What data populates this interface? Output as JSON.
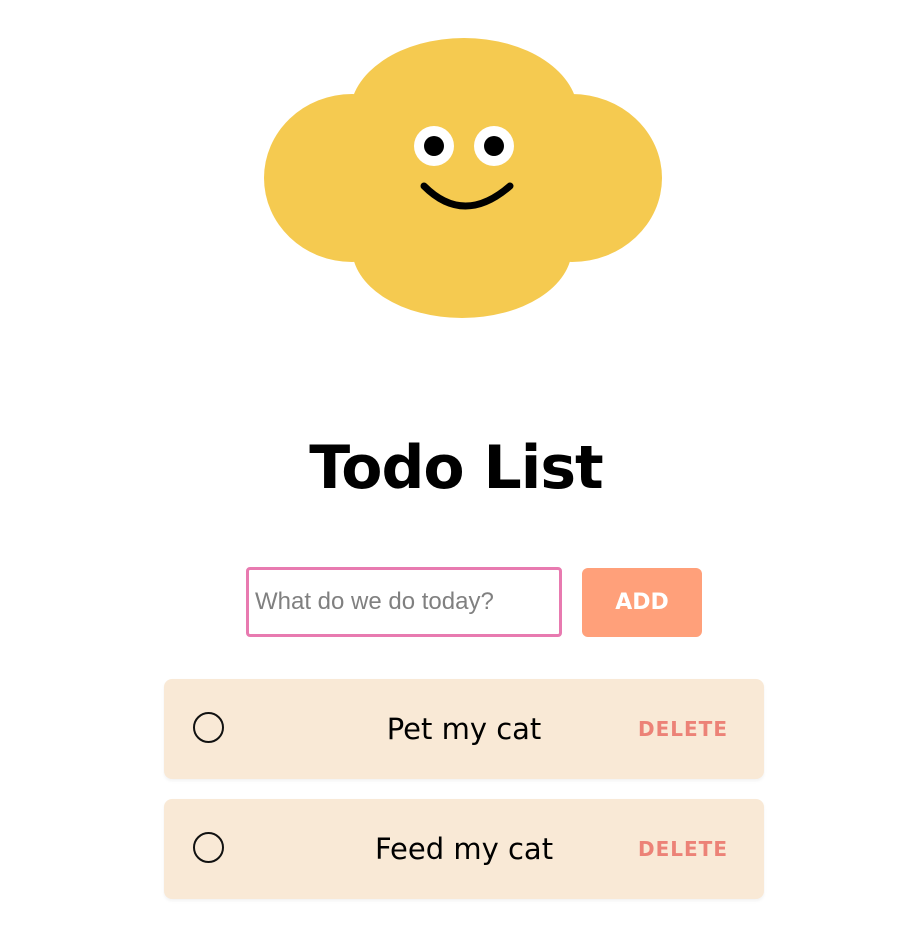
{
  "mascot": {
    "icon": "smiling-cloud-icon",
    "color": "#f5ca50"
  },
  "title": "Todo List",
  "form": {
    "input_value": "",
    "input_placeholder": "What do we do today?",
    "add_label": "ADD"
  },
  "todos": [
    {
      "text": "Pet my cat",
      "completed": false,
      "delete_label": "DELETE"
    },
    {
      "text": "Feed my cat",
      "completed": false,
      "delete_label": "DELETE"
    }
  ],
  "colors": {
    "input_border": "#e87ab0",
    "add_button": "#ffa07a",
    "item_background": "#f9e9d6",
    "delete_text": "#ec8277"
  }
}
